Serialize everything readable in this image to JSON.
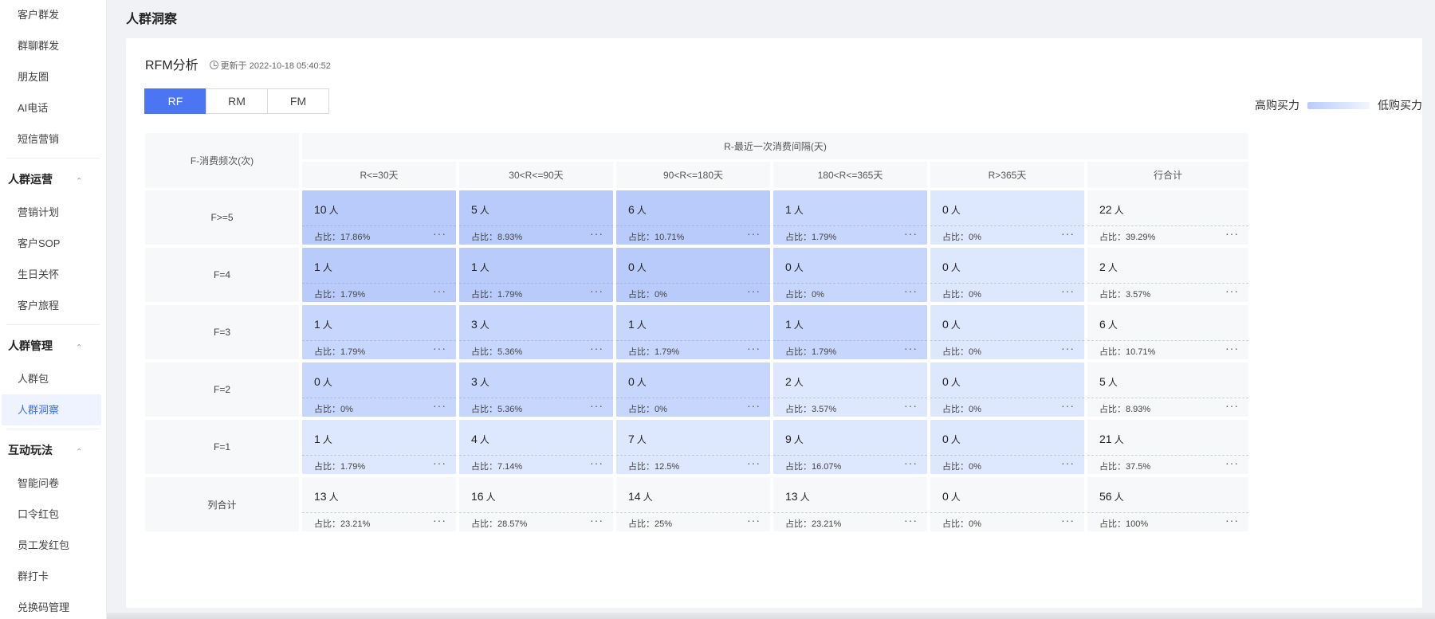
{
  "sidebar": {
    "top_items": [
      "客户群发",
      "群聊群发",
      "朋友圈",
      "AI电话",
      "短信营销"
    ],
    "groups": [
      {
        "title": "人群运营",
        "items": [
          "营销计划",
          "客户SOP",
          "生日关怀",
          "客户旅程"
        ]
      },
      {
        "title": "人群管理",
        "items": [
          "人群包",
          "人群洞察"
        ]
      },
      {
        "title": "互动玩法",
        "items": [
          "智能问卷",
          "口令红包",
          "员工发红包",
          "群打卡",
          "兑换码管理"
        ]
      }
    ],
    "active_item": "人群洞察"
  },
  "page": {
    "title": "人群洞察"
  },
  "card": {
    "title": "RFM分析",
    "update_text": "更新于 2022-10-18 05:40:52",
    "tabs": [
      "RF",
      "RM",
      "FM"
    ],
    "active_tab": "RF",
    "legend": {
      "high": "高购买力",
      "low": "低购买力",
      "high_color": "#b8cbfa",
      "low_color": "#f2f5ff"
    }
  },
  "table": {
    "row_header": "F-消费频次(次)",
    "col_group_header": "R-最近一次消费间隔(天)",
    "columns": [
      "R<=30天",
      "30<R<=90天",
      "90<R<=180天",
      "180<R<=365天",
      "R>365天",
      "行合计"
    ],
    "unit": "人",
    "pct_prefix": "占比：",
    "more_label": "···",
    "rows": [
      {
        "label": "F>=5",
        "cells": [
          {
            "count": "10",
            "pct": "17.86%",
            "level": 3
          },
          {
            "count": "5",
            "pct": "8.93%",
            "level": 3
          },
          {
            "count": "6",
            "pct": "10.71%",
            "level": 3
          },
          {
            "count": "1",
            "pct": "1.79%",
            "level": 2
          },
          {
            "count": "0",
            "pct": "0%",
            "level": 1
          },
          {
            "count": "22",
            "pct": "39.29%",
            "level": 0
          }
        ]
      },
      {
        "label": "F=4",
        "cells": [
          {
            "count": "1",
            "pct": "1.79%",
            "level": 3
          },
          {
            "count": "1",
            "pct": "1.79%",
            "level": 3
          },
          {
            "count": "0",
            "pct": "0%",
            "level": 3
          },
          {
            "count": "0",
            "pct": "0%",
            "level": 2
          },
          {
            "count": "0",
            "pct": "0%",
            "level": 1
          },
          {
            "count": "2",
            "pct": "3.57%",
            "level": 0
          }
        ]
      },
      {
        "label": "F=3",
        "cells": [
          {
            "count": "1",
            "pct": "1.79%",
            "level": 2
          },
          {
            "count": "3",
            "pct": "5.36%",
            "level": 2
          },
          {
            "count": "1",
            "pct": "1.79%",
            "level": 2
          },
          {
            "count": "1",
            "pct": "1.79%",
            "level": 2
          },
          {
            "count": "0",
            "pct": "0%",
            "level": 1
          },
          {
            "count": "6",
            "pct": "10.71%",
            "level": 0
          }
        ]
      },
      {
        "label": "F=2",
        "cells": [
          {
            "count": "0",
            "pct": "0%",
            "level": 2
          },
          {
            "count": "3",
            "pct": "5.36%",
            "level": 2
          },
          {
            "count": "0",
            "pct": "0%",
            "level": 2
          },
          {
            "count": "2",
            "pct": "3.57%",
            "level": 1
          },
          {
            "count": "0",
            "pct": "0%",
            "level": 1
          },
          {
            "count": "5",
            "pct": "8.93%",
            "level": 0
          }
        ]
      },
      {
        "label": "F=1",
        "cells": [
          {
            "count": "1",
            "pct": "1.79%",
            "level": 1
          },
          {
            "count": "4",
            "pct": "7.14%",
            "level": 1
          },
          {
            "count": "7",
            "pct": "12.5%",
            "level": 1
          },
          {
            "count": "9",
            "pct": "16.07%",
            "level": 1
          },
          {
            "count": "0",
            "pct": "0%",
            "level": 1
          },
          {
            "count": "21",
            "pct": "37.5%",
            "level": 0
          }
        ]
      },
      {
        "label": "列合计",
        "cells": [
          {
            "count": "13",
            "pct": "23.21%",
            "level": 0
          },
          {
            "count": "16",
            "pct": "28.57%",
            "level": 0
          },
          {
            "count": "14",
            "pct": "25%",
            "level": 0
          },
          {
            "count": "13",
            "pct": "23.21%",
            "level": 0
          },
          {
            "count": "0",
            "pct": "0%",
            "level": 0
          },
          {
            "count": "56",
            "pct": "100%",
            "level": 0
          }
        ]
      }
    ],
    "level_colors": [
      "#f7f8fa",
      "#dde7fd",
      "#c6d6fc",
      "#b8cbfa"
    ]
  }
}
